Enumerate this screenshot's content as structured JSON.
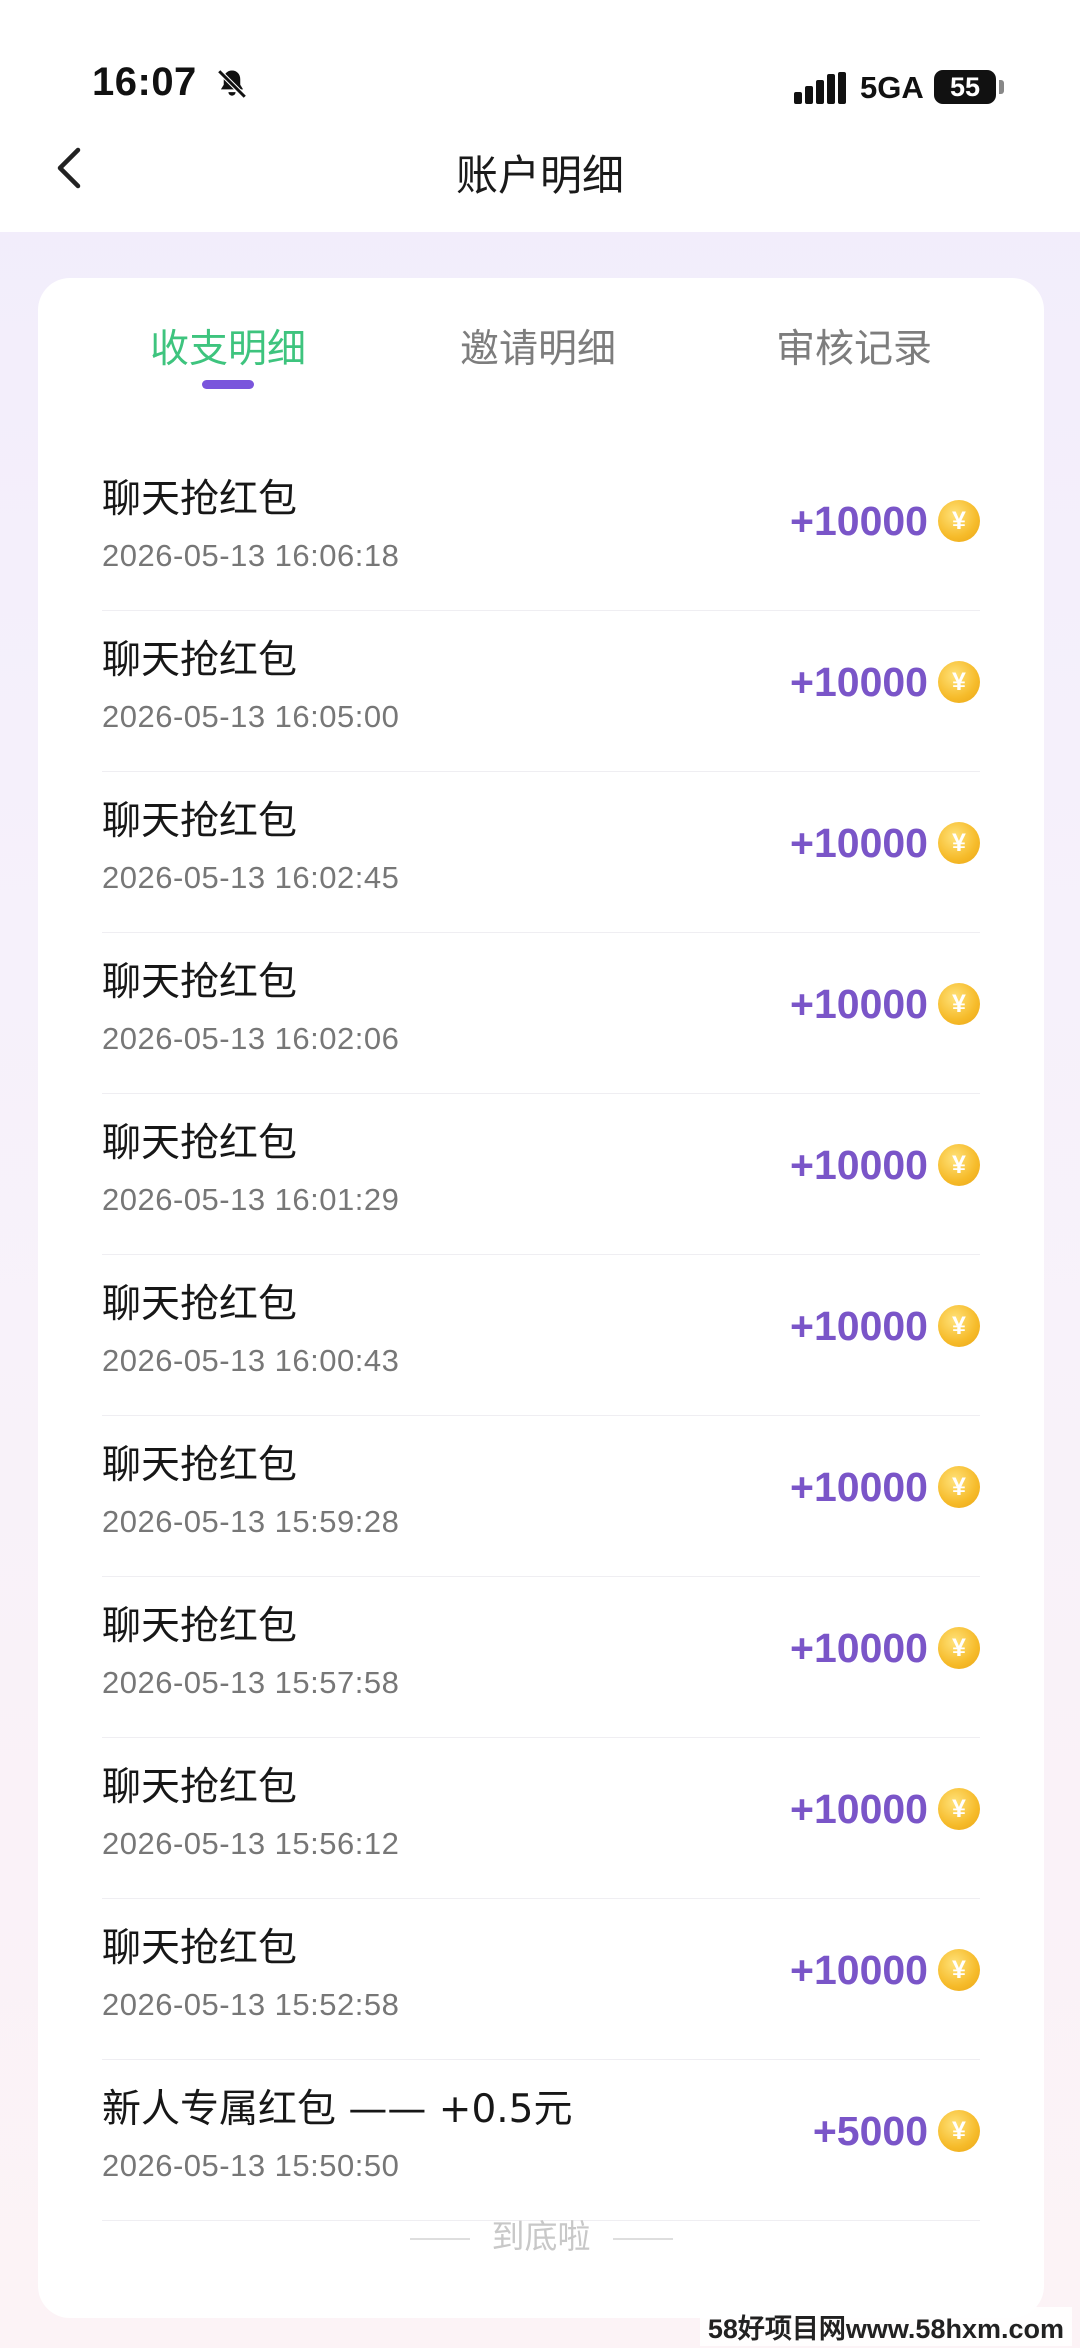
{
  "status_bar": {
    "time": "16:07",
    "network": "5GA",
    "battery": "55",
    "icons": [
      "bell-muted-icon",
      "signal-icon",
      "battery-icon"
    ]
  },
  "header": {
    "title": "账户明细",
    "back_icon": "chevron-left-icon"
  },
  "tabs": [
    {
      "label": "收支明细",
      "active": true
    },
    {
      "label": "邀请明细",
      "active": false
    },
    {
      "label": "审核记录",
      "active": false
    }
  ],
  "colors": {
    "active_tab": "#3ec47e",
    "indicator": "#7a55dc",
    "amount": "#7a55c8",
    "coin": "#f6bb2a"
  },
  "records": [
    {
      "title": "聊天抢红包",
      "time": "2026-05-13 16:06:18",
      "amount": "+10000"
    },
    {
      "title": "聊天抢红包",
      "time": "2026-05-13 16:05:00",
      "amount": "+10000"
    },
    {
      "title": "聊天抢红包",
      "time": "2026-05-13 16:02:45",
      "amount": "+10000"
    },
    {
      "title": "聊天抢红包",
      "time": "2026-05-13 16:02:06",
      "amount": "+10000"
    },
    {
      "title": "聊天抢红包",
      "time": "2026-05-13 16:01:29",
      "amount": "+10000"
    },
    {
      "title": "聊天抢红包",
      "time": "2026-05-13 16:00:43",
      "amount": "+10000"
    },
    {
      "title": "聊天抢红包",
      "time": "2026-05-13 15:59:28",
      "amount": "+10000"
    },
    {
      "title": "聊天抢红包",
      "time": "2026-05-13 15:57:58",
      "amount": "+10000"
    },
    {
      "title": "聊天抢红包",
      "time": "2026-05-13 15:56:12",
      "amount": "+10000"
    },
    {
      "title": "聊天抢红包",
      "time": "2026-05-13 15:52:58",
      "amount": "+10000"
    },
    {
      "title": "新人专属红包 —— +0.5元",
      "time": "2026-05-13 15:50:50",
      "amount": "+5000"
    }
  ],
  "coin_symbol": "¥",
  "footer": "到底啦",
  "watermark": "58好项目网www.58hxm.com"
}
